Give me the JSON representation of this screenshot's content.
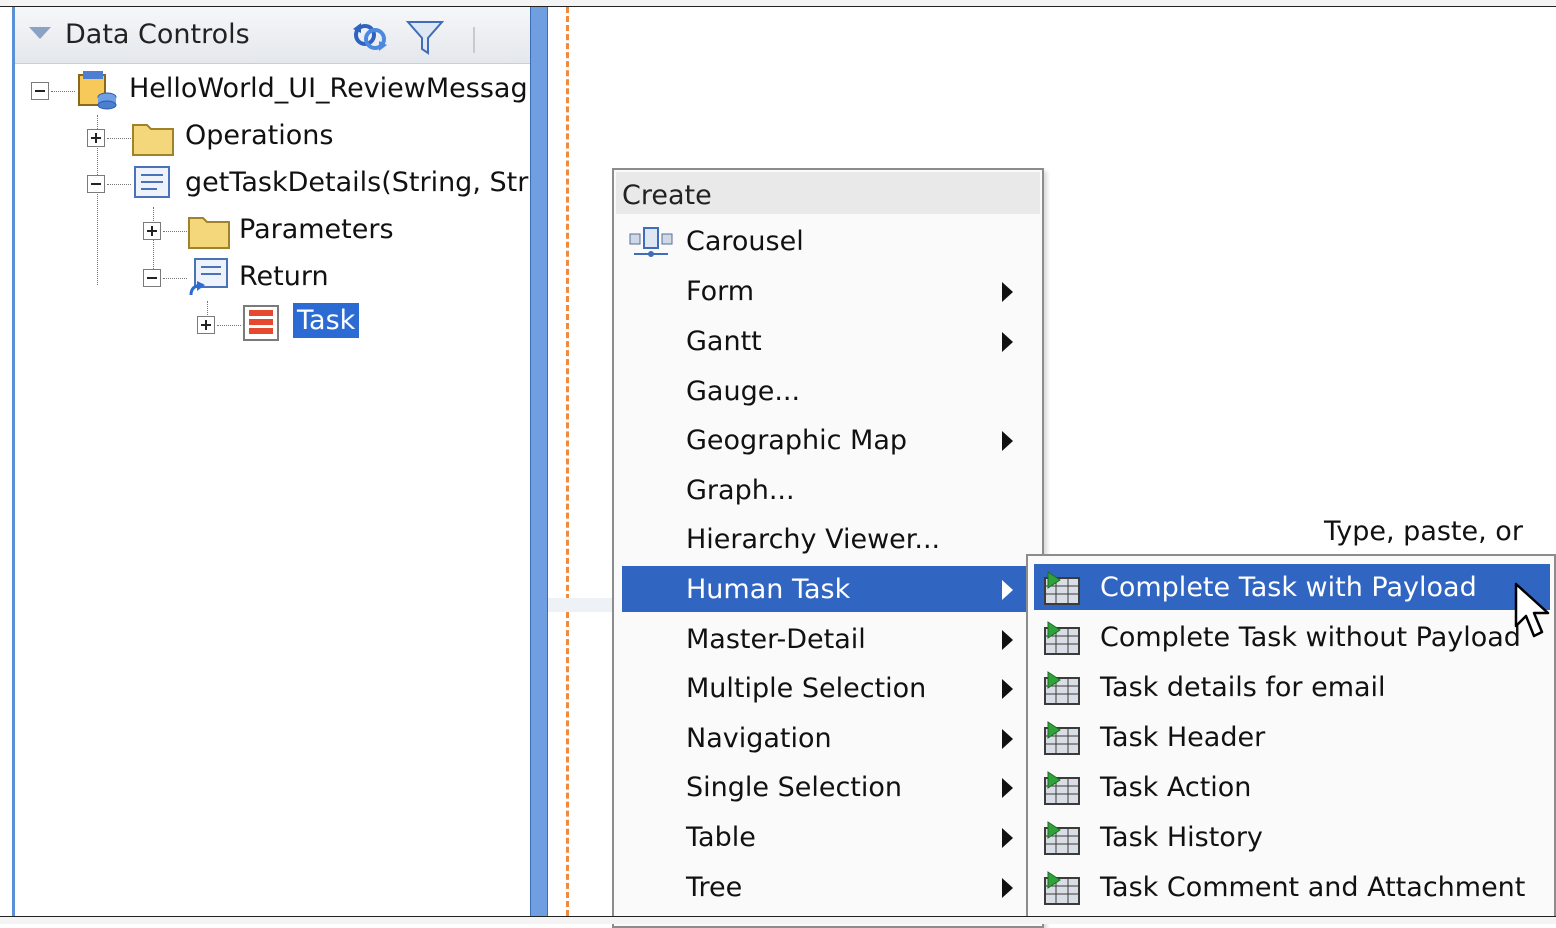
{
  "panel": {
    "title": "Data Controls",
    "tree": [
      {
        "label": "HelloWorld_UI_ReviewMessag"
      },
      {
        "label": "Operations"
      },
      {
        "label": "getTaskDetails(String, Stri"
      },
      {
        "label": "Parameters"
      },
      {
        "label": "Return"
      },
      {
        "label": "Task"
      }
    ]
  },
  "menu": {
    "header": "Create",
    "items": [
      {
        "label": "Carousel"
      },
      {
        "label": "Form"
      },
      {
        "label": "Gantt"
      },
      {
        "label": "Gauge..."
      },
      {
        "label": "Geographic Map"
      },
      {
        "label": "Graph..."
      },
      {
        "label": "Hierarchy Viewer..."
      },
      {
        "label": "Human Task"
      },
      {
        "label": "Master-Detail"
      },
      {
        "label": "Multiple Selection"
      },
      {
        "label": "Navigation"
      },
      {
        "label": "Single Selection"
      },
      {
        "label": "Table"
      },
      {
        "label": "Tree"
      }
    ]
  },
  "submenu": {
    "items": [
      {
        "label": "Complete Task with Payload"
      },
      {
        "label": "Complete Task without Payload"
      },
      {
        "label": "Task details for email"
      },
      {
        "label": "Task Header"
      },
      {
        "label": "Task Action"
      },
      {
        "label": "Task History"
      },
      {
        "label": "Task Comment and Attachment"
      }
    ]
  },
  "canvas": {
    "hint": "Type, paste, or"
  },
  "colors": {
    "selection": "#3165c2",
    "splitter": "#6f9fe0",
    "dashed_guide": "#f08a3c"
  }
}
